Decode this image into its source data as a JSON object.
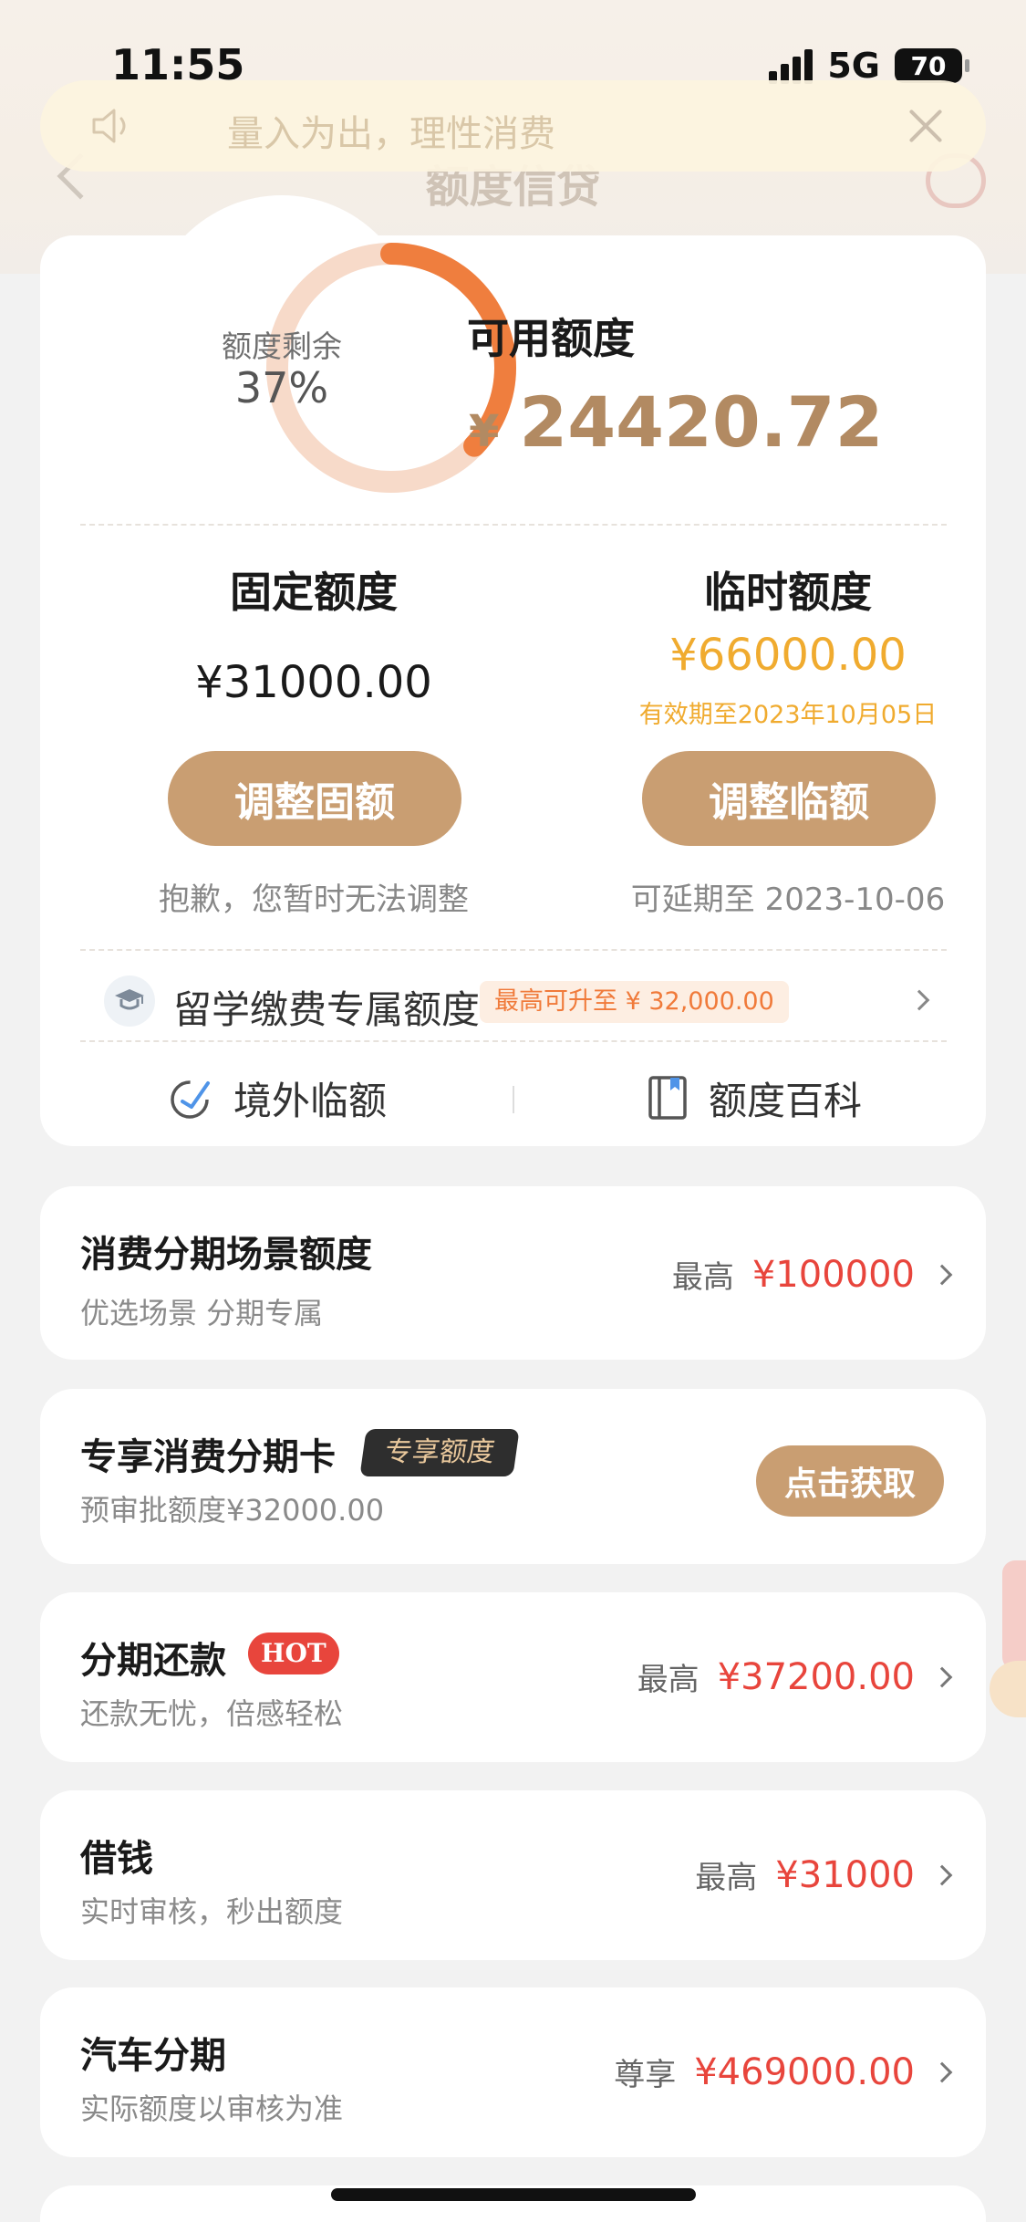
{
  "status_bar": {
    "time": "11:55",
    "network": "5G",
    "battery": "70"
  },
  "nav": {
    "title": "额度信贷"
  },
  "notice": {
    "text": "量入为出，理性消费"
  },
  "credit": {
    "ring_label": "额度剩余",
    "ring_percent": "37%",
    "ring_fraction": 0.37,
    "available_label": "可用额度",
    "currency": "¥",
    "available_amount": "24420.72",
    "fixed": {
      "title": "固定额度",
      "amount": "¥31000.00",
      "button": "调整固额",
      "note": "抱歉，您暂时无法调整"
    },
    "temporary": {
      "title": "临时额度",
      "amount": "¥66000.00",
      "valid": "有效期至2023年10月05日",
      "button": "调整临额",
      "note": "可延期至 2023-10-06"
    },
    "study": {
      "label": "留学缴费专属额度",
      "badge": "最高可升至 ¥ 32,000.00"
    },
    "links": {
      "overseas": "境外临额",
      "wiki": "额度百科"
    }
  },
  "rows": {
    "scene": {
      "title": "消费分期场景额度",
      "sub": "优选场景 分期专属",
      "prefix": "最高",
      "value": "¥100000"
    },
    "card": {
      "title": "专享消费分期卡",
      "tag": "专享额度",
      "sub": "预审批额度¥32000.00",
      "button": "点击获取"
    },
    "repay": {
      "title": "分期还款",
      "hot": "HOT",
      "sub": "还款无忧，倍感轻松",
      "prefix": "最高",
      "value": "¥37200.00"
    },
    "borrow": {
      "title": "借钱",
      "sub": "实时审核，秒出额度",
      "prefix": "最高",
      "value": "¥31000"
    },
    "car": {
      "title": "汽车分期",
      "sub": "实际额度以审核为准",
      "prefix": "尊享",
      "value": "¥469000.00"
    }
  },
  "colors": {
    "accent": "#c99e72",
    "amount": "#b28a62",
    "ring": "#ef7e3e",
    "ring_bg": "#f7d9c8",
    "red": "#e8453c",
    "temp": "#f0ab2f"
  }
}
